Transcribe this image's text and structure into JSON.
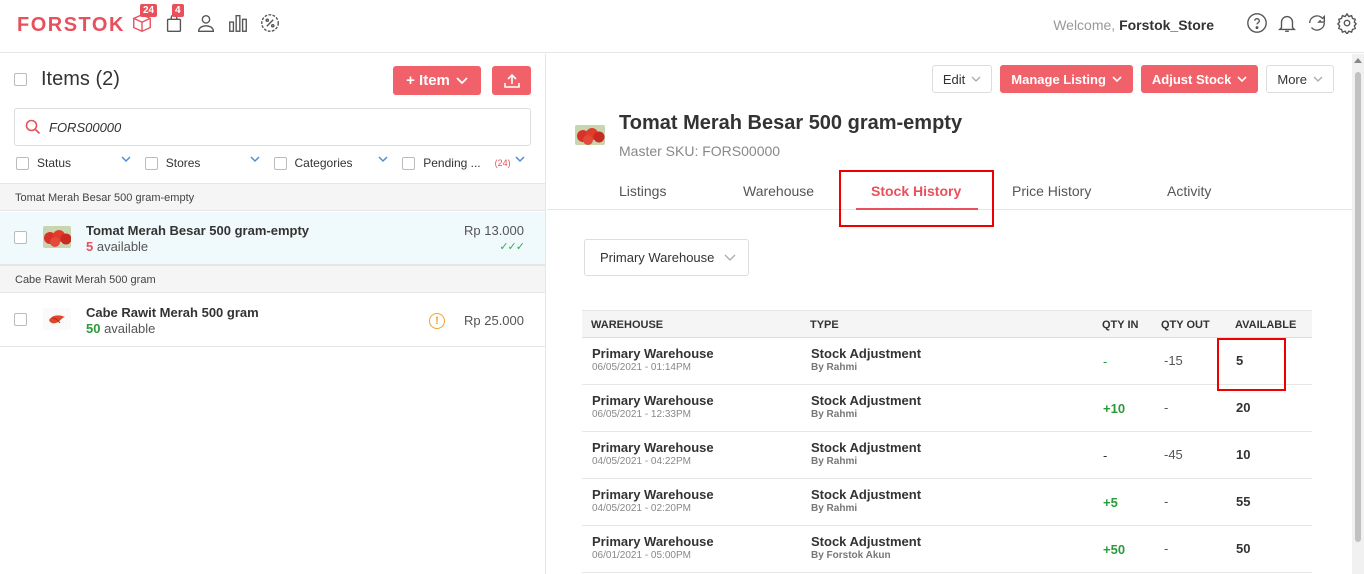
{
  "app": {
    "logo": "FORSTOK",
    "welcome_prefix": "Welcome, ",
    "welcome_user": "Forstok_Store"
  },
  "topnav": [
    {
      "icon": "box-icon",
      "badge": "24"
    },
    {
      "icon": "bag-icon",
      "badge": "4"
    },
    {
      "icon": "user-icon",
      "badge": ""
    },
    {
      "icon": "bar-chart-icon",
      "badge": ""
    },
    {
      "icon": "percent-icon",
      "badge": ""
    }
  ],
  "left": {
    "title": "Items (2)",
    "add_item_label": "+ Item",
    "search_value": "FORS00000",
    "filters": [
      {
        "label": "Status",
        "count": ""
      },
      {
        "label": "Stores",
        "count": ""
      },
      {
        "label": "Categories",
        "count": ""
      },
      {
        "label": "Pending ...",
        "count": "(24)"
      }
    ],
    "groups": [
      {
        "header": "Tomat Merah Besar 500 gram-empty",
        "item": {
          "name": "Tomat Merah Besar 500 gram-empty",
          "available_num": "5",
          "available_text": " available",
          "price": "Rp 13.000"
        }
      },
      {
        "header": "Cabe Rawit Merah 500 gram",
        "item": {
          "name": "Cabe Rawit Merah 500 gram",
          "available_num": "50",
          "available_text": " available",
          "price": "Rp 25.000"
        }
      }
    ]
  },
  "product": {
    "title": "Tomat Merah Besar 500 gram-empty",
    "sku": "Master SKU: FORS00000",
    "actions": {
      "edit": "Edit",
      "manage": "Manage Listing",
      "adjust": "Adjust Stock",
      "more": "More"
    },
    "tabs": [
      "Listings",
      "Warehouse",
      "Stock History",
      "Price History",
      "Activity"
    ],
    "active_tab": "Stock History",
    "warehouse_select": "Primary Warehouse"
  },
  "table": {
    "headers": {
      "warehouse": "WAREHOUSE",
      "type": "TYPE",
      "qty_in": "QTY IN",
      "qty_out": "QTY OUT",
      "available": "AVAILABLE"
    },
    "rows": [
      {
        "warehouse": "Primary Warehouse",
        "date": "06/05/2021 - 01:14PM",
        "type": "Stock Adjustment",
        "by": "By Rahmi",
        "qty_in": "-",
        "qty_out": "-15",
        "available": "5"
      },
      {
        "warehouse": "Primary Warehouse",
        "date": "06/05/2021 - 12:33PM",
        "type": "Stock Adjustment",
        "by": "By Rahmi",
        "qty_in": "+10",
        "qty_out": "-",
        "available": "20"
      },
      {
        "warehouse": "Primary Warehouse",
        "date": "04/05/2021 - 04:22PM",
        "type": "Stock Adjustment",
        "by": "By Rahmi",
        "qty_in": "-",
        "qty_out": "-45",
        "available": "10"
      },
      {
        "warehouse": "Primary Warehouse",
        "date": "04/05/2021 - 02:20PM",
        "type": "Stock Adjustment",
        "by": "By Rahmi",
        "qty_in": "+5",
        "qty_out": "-",
        "available": "55"
      },
      {
        "warehouse": "Primary Warehouse",
        "date": "06/01/2021 - 05:00PM",
        "type": "Stock Adjustment",
        "by": "By Forstok Akun",
        "qty_in": "+50",
        "qty_out": "-",
        "available": "50"
      }
    ]
  },
  "colors": {
    "brand": "#e8505b",
    "green": "#2b9a3a",
    "highlight": "#ee0000"
  }
}
